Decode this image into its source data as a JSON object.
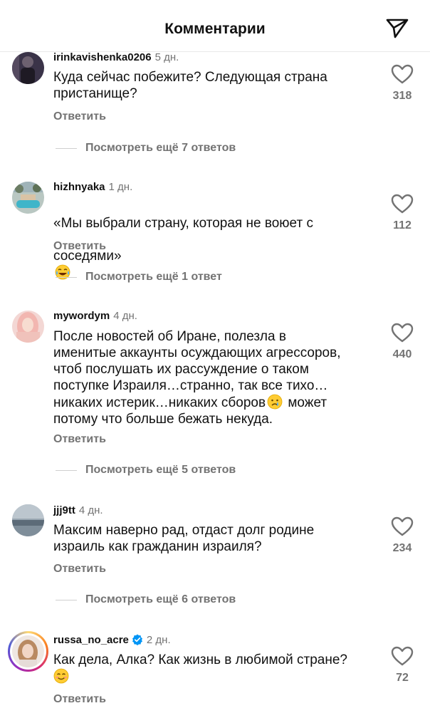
{
  "header": {
    "title": "Комментарии",
    "share_icon": "paper-plane-icon"
  },
  "comments": [
    {
      "username": "irinkavishenka0206",
      "time": "5 дн.",
      "text": "Куда сейчас побежите? Следующая страна\nпристанище?",
      "likes": "318",
      "reply_label": "Ответить",
      "view_more": "Посмотреть ещё 7 ответов"
    },
    {
      "username": "hizhnyaka",
      "time": "1 дн.",
      "text_line1": "«Мы выбрали страну, которая не воюет с",
      "text_line2": "соседями»",
      "emoji": "tears-of-joy-emoji",
      "likes": "112",
      "reply_label": "Ответить",
      "view_more": "Посмотреть ещё 1 ответ"
    },
    {
      "username": "mywordym",
      "time": "4 дн.",
      "text_part1": "После новостей об Иране, полезла в\nименитые аккаунты осуждающих агрессоров,\nчтоб послушать их рассуждение о таком\nпоступке Израиля…странно, так все тихо…\nникаких истерик…никаких сборов",
      "emoji": "crying-face-emoji",
      "text_part2": " может\nпотому что больше бежать некуда.",
      "likes": "440",
      "reply_label": "Ответить",
      "view_more": "Посмотреть ещё 5 ответов"
    },
    {
      "username": "jjj9tt",
      "time": "4 дн.",
      "text": "Максим наверно рад, отдаст долг родине\nизраиль как гражданин израиля?",
      "likes": "234",
      "reply_label": "Ответить",
      "view_more": "Посмотреть ещё 6 ответов"
    },
    {
      "username": "russa_no_acre",
      "time": "2 дн.",
      "verified": true,
      "text": "Как дела, Алка?  Как жизнь в любимой стране?",
      "emoji": "smiling-face-emoji",
      "likes": "72",
      "reply_label": "Ответить"
    }
  ],
  "colors": {
    "secondary_text": "#737373",
    "primary_text": "#111111",
    "verified_blue": "#0095f6"
  }
}
